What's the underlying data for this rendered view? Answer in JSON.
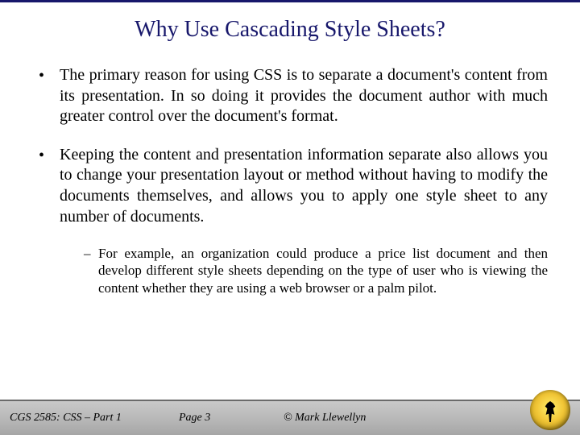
{
  "title": "Why Use Cascading Style Sheets?",
  "bullets": [
    "The primary reason for using CSS is to separate a document's content from its presentation.  In so doing it provides the document author with much greater control over the document's format.",
    "Keeping the content and presentation information separate also allows you to change your presentation layout or method without having to modify the documents themselves, and allows you to apply one style sheet to any number of documents."
  ],
  "subbullet": "For example, an organization could produce a price list document and then develop different style sheets depending on the type of user who is viewing the content whether they are using a web browser or a palm pilot.",
  "footer": {
    "course": "CGS 2585: CSS – Part 1",
    "page": "Page 3",
    "copyright": "© Mark Llewellyn"
  }
}
